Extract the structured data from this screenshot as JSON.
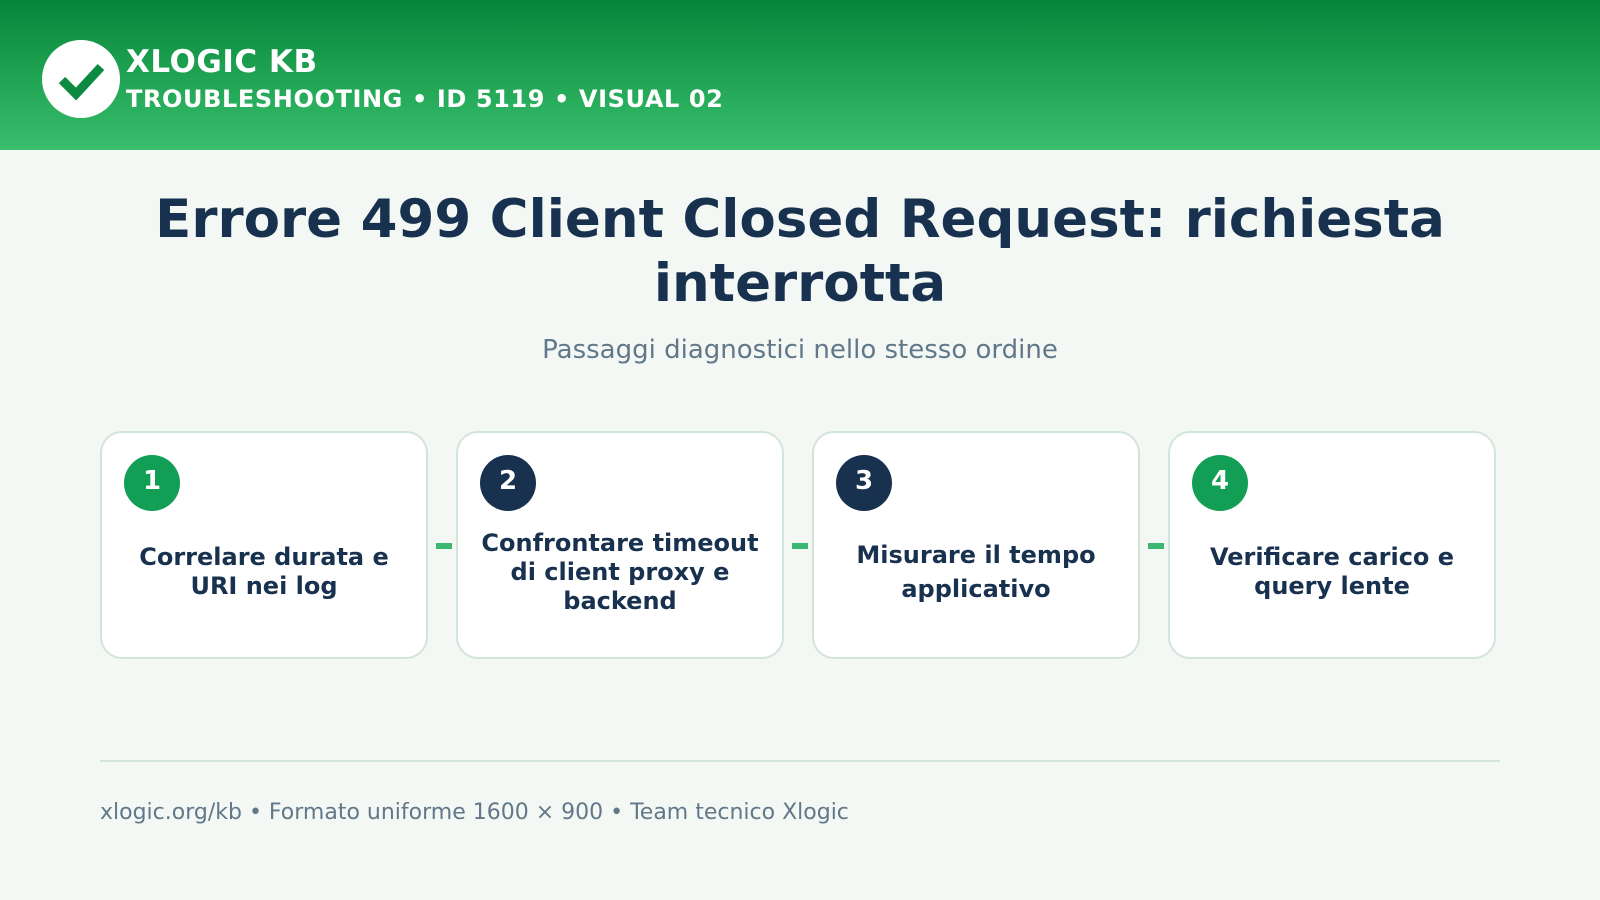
{
  "header": {
    "brand": "XLOGIC KB",
    "meta": "TROUBLESHOOTING • ID 5119 • VISUAL 02",
    "logo_icon": "checkmark-icon",
    "colors": {
      "band_top": "#06843a",
      "band_bottom": "#38be6d"
    }
  },
  "main": {
    "title": "Errore 499 Client Closed Request: richiesta interrotta",
    "subtitle": "Passaggi diagnostici nello stesso ordine"
  },
  "steps": [
    {
      "number": "1",
      "label": "Correlare durata e URI nei log",
      "badge_color": "#139e55"
    },
    {
      "number": "2",
      "label": "Confrontare timeout di client proxy e backend",
      "badge_color": "#17314f"
    },
    {
      "number": "3",
      "label": "Misurare il tempo applicativo",
      "badge_color": "#17314f"
    },
    {
      "number": "4",
      "label": "Verificare carico e query lente",
      "badge_color": "#139e55"
    }
  ],
  "footer": {
    "text": "xlogic.org/kb • Formato uniforme 1600 × 900 • Team tecnico Xlogic"
  },
  "colors": {
    "text_primary": "#17314f",
    "text_muted": "#627889",
    "accent": "#3cb872",
    "card_border": "#d3e4da",
    "background": "#f3f8f5"
  }
}
